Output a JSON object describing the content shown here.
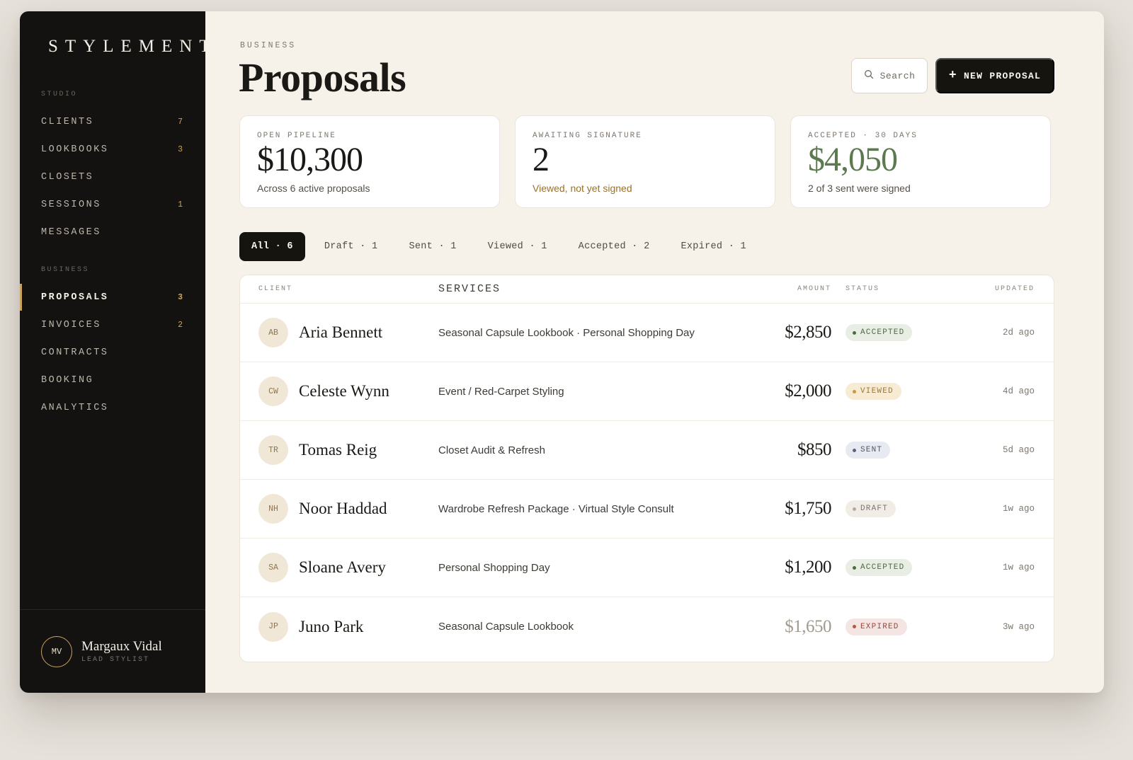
{
  "brand": "STYLEMENT",
  "sidebar": {
    "studio_label": "STUDIO",
    "studio_items": [
      {
        "label": "CLIENTS",
        "count": "7"
      },
      {
        "label": "LOOKBOOKS",
        "count": "3"
      },
      {
        "label": "CLOSETS",
        "count": ""
      },
      {
        "label": "SESSIONS",
        "count": "1"
      },
      {
        "label": "MESSAGES",
        "count": ""
      }
    ],
    "business_label": "BUSINESS",
    "business_items": [
      {
        "label": "PROPOSALS",
        "count": "3",
        "active": true
      },
      {
        "label": "INVOICES",
        "count": "2"
      },
      {
        "label": "CONTRACTS",
        "count": ""
      },
      {
        "label": "BOOKING",
        "count": ""
      },
      {
        "label": "ANALYTICS",
        "count": ""
      }
    ],
    "user": {
      "initials": "MV",
      "name": "Margaux Vidal",
      "role": "LEAD STYLIST"
    }
  },
  "header": {
    "eyebrow": "BUSINESS",
    "title": "Proposals",
    "search_label": "Search",
    "new_button": "NEW PROPOSAL"
  },
  "stats": [
    {
      "label": "OPEN PIPELINE",
      "value": "$10,300",
      "sub": "Across 6 active proposals",
      "value_color": "#1b1916",
      "sub_color": "#55504a"
    },
    {
      "label": "AWAITING SIGNATURE",
      "value": "2",
      "sub": "Viewed, not yet signed",
      "value_color": "#1b1916",
      "sub_color": "#9a7128"
    },
    {
      "label": "ACCEPTED · 30 DAYS",
      "value": "$4,050",
      "sub": "2 of 3 sent were signed",
      "value_color": "#5d7a4e",
      "sub_color": "#55504a"
    }
  ],
  "tabs": [
    {
      "label": "All · 6",
      "active": true
    },
    {
      "label": "Draft · 1"
    },
    {
      "label": "Sent · 1"
    },
    {
      "label": "Viewed · 1"
    },
    {
      "label": "Accepted · 2"
    },
    {
      "label": "Expired · 1"
    }
  ],
  "table": {
    "columns": {
      "client": "CLIENT",
      "services": "SERVICES",
      "amount": "AMOUNT",
      "status": "STATUS",
      "updated": "UPDATED"
    },
    "rows": [
      {
        "initials": "AB",
        "client": "Aria Bennett",
        "services": "Seasonal Capsule Lookbook · Personal Shopping Day",
        "amount": "$2,850",
        "status": "ACCEPTED",
        "status_key": "accepted",
        "updated": "2d ago"
      },
      {
        "initials": "CW",
        "client": "Celeste Wynn",
        "services": "Event / Red-Carpet Styling",
        "amount": "$2,000",
        "status": "VIEWED",
        "status_key": "viewed",
        "updated": "4d ago"
      },
      {
        "initials": "TR",
        "client": "Tomas Reig",
        "services": "Closet Audit & Refresh",
        "amount": "$850",
        "status": "SENT",
        "status_key": "sent",
        "updated": "5d ago"
      },
      {
        "initials": "NH",
        "client": "Noor Haddad",
        "services": "Wardrobe Refresh Package · Virtual Style Consult",
        "amount": "$1,750",
        "status": "DRAFT",
        "status_key": "draft",
        "updated": "1w ago"
      },
      {
        "initials": "SA",
        "client": "Sloane Avery",
        "services": "Personal Shopping Day",
        "amount": "$1,200",
        "status": "ACCEPTED",
        "status_key": "accepted",
        "updated": "1w ago"
      },
      {
        "initials": "JP",
        "client": "Juno Park",
        "services": "Seasonal Capsule Lookbook",
        "amount": "$1,650",
        "status": "EXPIRED",
        "status_key": "expired",
        "updated": "3w ago",
        "muted": true
      }
    ]
  }
}
